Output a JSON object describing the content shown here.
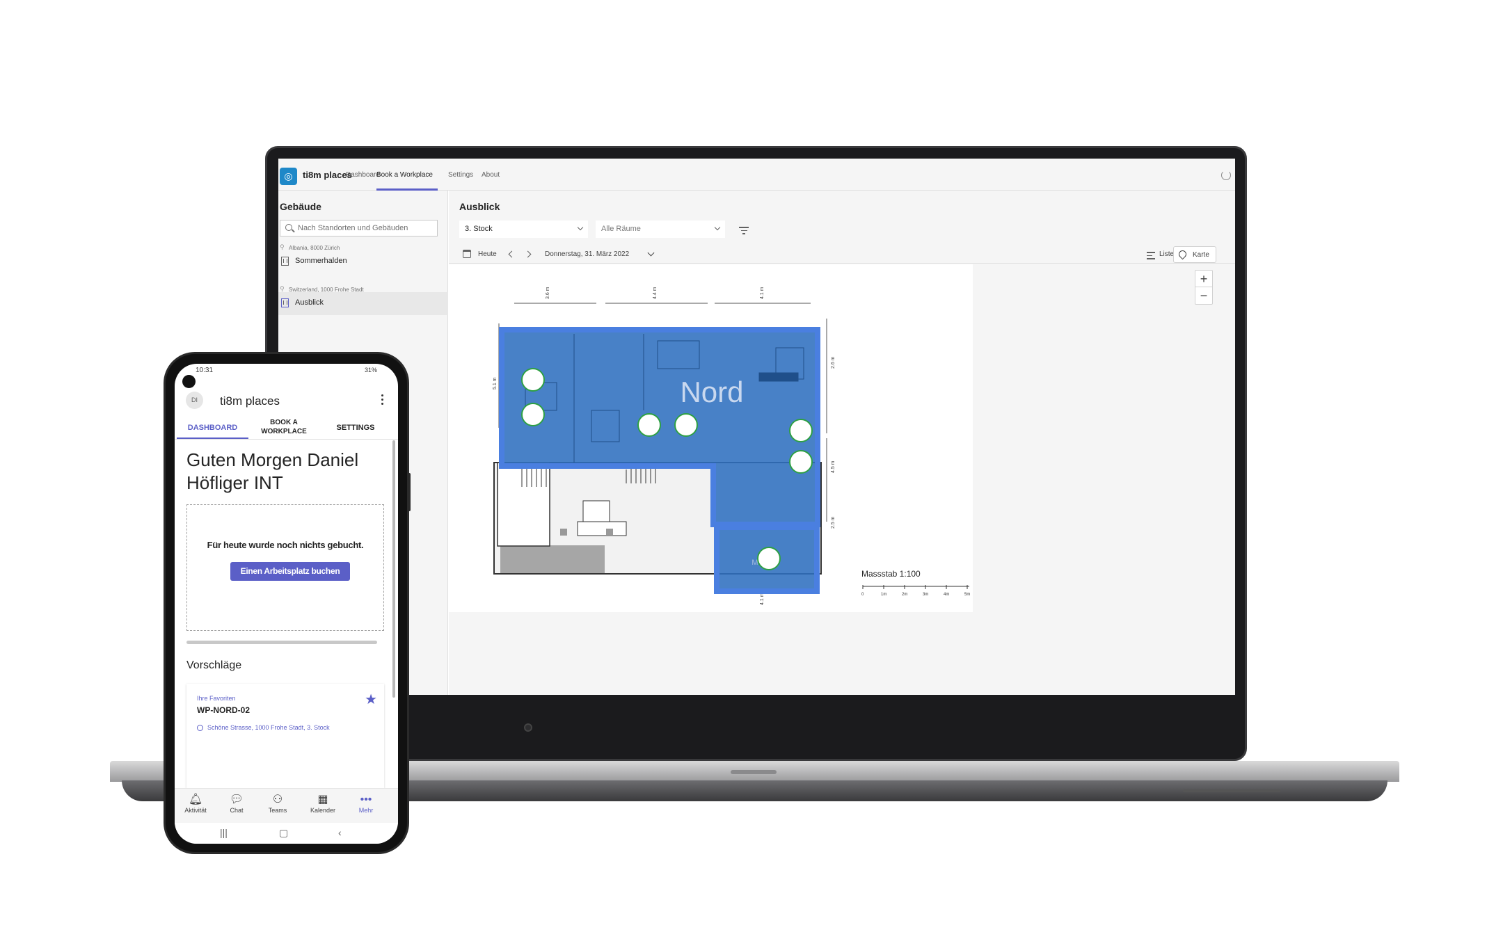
{
  "colors": {
    "accent": "#5b5fc7",
    "zone": "#2f6fbf",
    "zone_border": "#4a7fe0",
    "seat": "#ffffff",
    "seat_border": "#2ea043"
  },
  "laptop": {
    "app": {
      "name": "ti8m places",
      "logo_icon": "places-logo-icon",
      "tabs": [
        {
          "label": "Dashboard",
          "active": false
        },
        {
          "label": "Book a Workplace",
          "active": true
        },
        {
          "label": "Settings",
          "active": false
        },
        {
          "label": "About",
          "active": false
        }
      ]
    },
    "sidebar": {
      "title": "Gebäude",
      "search_placeholder": "Nach Standorten und Gebäuden",
      "groups": [
        {
          "location": "Albania, 8000 Zürich",
          "building": "Sommerhalden",
          "active": false
        },
        {
          "location": "Switzerland, 1000 Frohe Stadt",
          "building": "Ausblick",
          "active": true
        }
      ]
    },
    "main": {
      "title": "Ausblick",
      "floor_select": "3. Stock",
      "room_select": "Alle Räume",
      "today": "Heute",
      "date": "Donnerstag, 31. März 2022",
      "view_list": "Liste",
      "view_map": "Karte",
      "zoom_in": "+",
      "zoom_out": "−",
      "map": {
        "zone_north": "Nord",
        "zone_meeting": "Meeting",
        "scale": "Massstab 1:100",
        "scale_ticks": [
          "0",
          "1m",
          "2m",
          "3m",
          "4m",
          "5m"
        ],
        "dimensions": [
          "3.6 m",
          "4.4 m",
          "4.1 m",
          "5.1 m",
          "2.6 m",
          "4.5 m",
          "2.5 m",
          "4.1 m"
        ],
        "seat_count": 8
      }
    }
  },
  "phone": {
    "status_time": "10:31",
    "status_right": "31%",
    "avatar_initials": "DI",
    "app_title": "ti8m places",
    "tabs": [
      "DASHBOARD",
      "BOOK A WORKPLACE",
      "SETTINGS"
    ],
    "greeting": "Guten Morgen Daniel Höfliger INT",
    "empty_text": "Für heute wurde noch nichts gebucht.",
    "book_button": "Einen Arbeitsplatz buchen",
    "suggestions_title": "Vorschläge",
    "card": {
      "label": "Ihre Favoriten",
      "workplace": "WP-NORD-02",
      "address": "Schöne Strasse, 1000 Frohe Stadt, 3. Stock"
    },
    "bottom_nav": [
      {
        "label": "Aktivität",
        "icon": "bell-icon",
        "glyph": "🔔"
      },
      {
        "label": "Chat",
        "icon": "chat-icon",
        "glyph": "💬"
      },
      {
        "label": "Teams",
        "icon": "teams-icon",
        "glyph": "👥"
      },
      {
        "label": "Kalender",
        "icon": "calendar-icon",
        "glyph": "📅"
      },
      {
        "label": "Mehr",
        "icon": "more-icon",
        "glyph": "•••"
      }
    ]
  }
}
